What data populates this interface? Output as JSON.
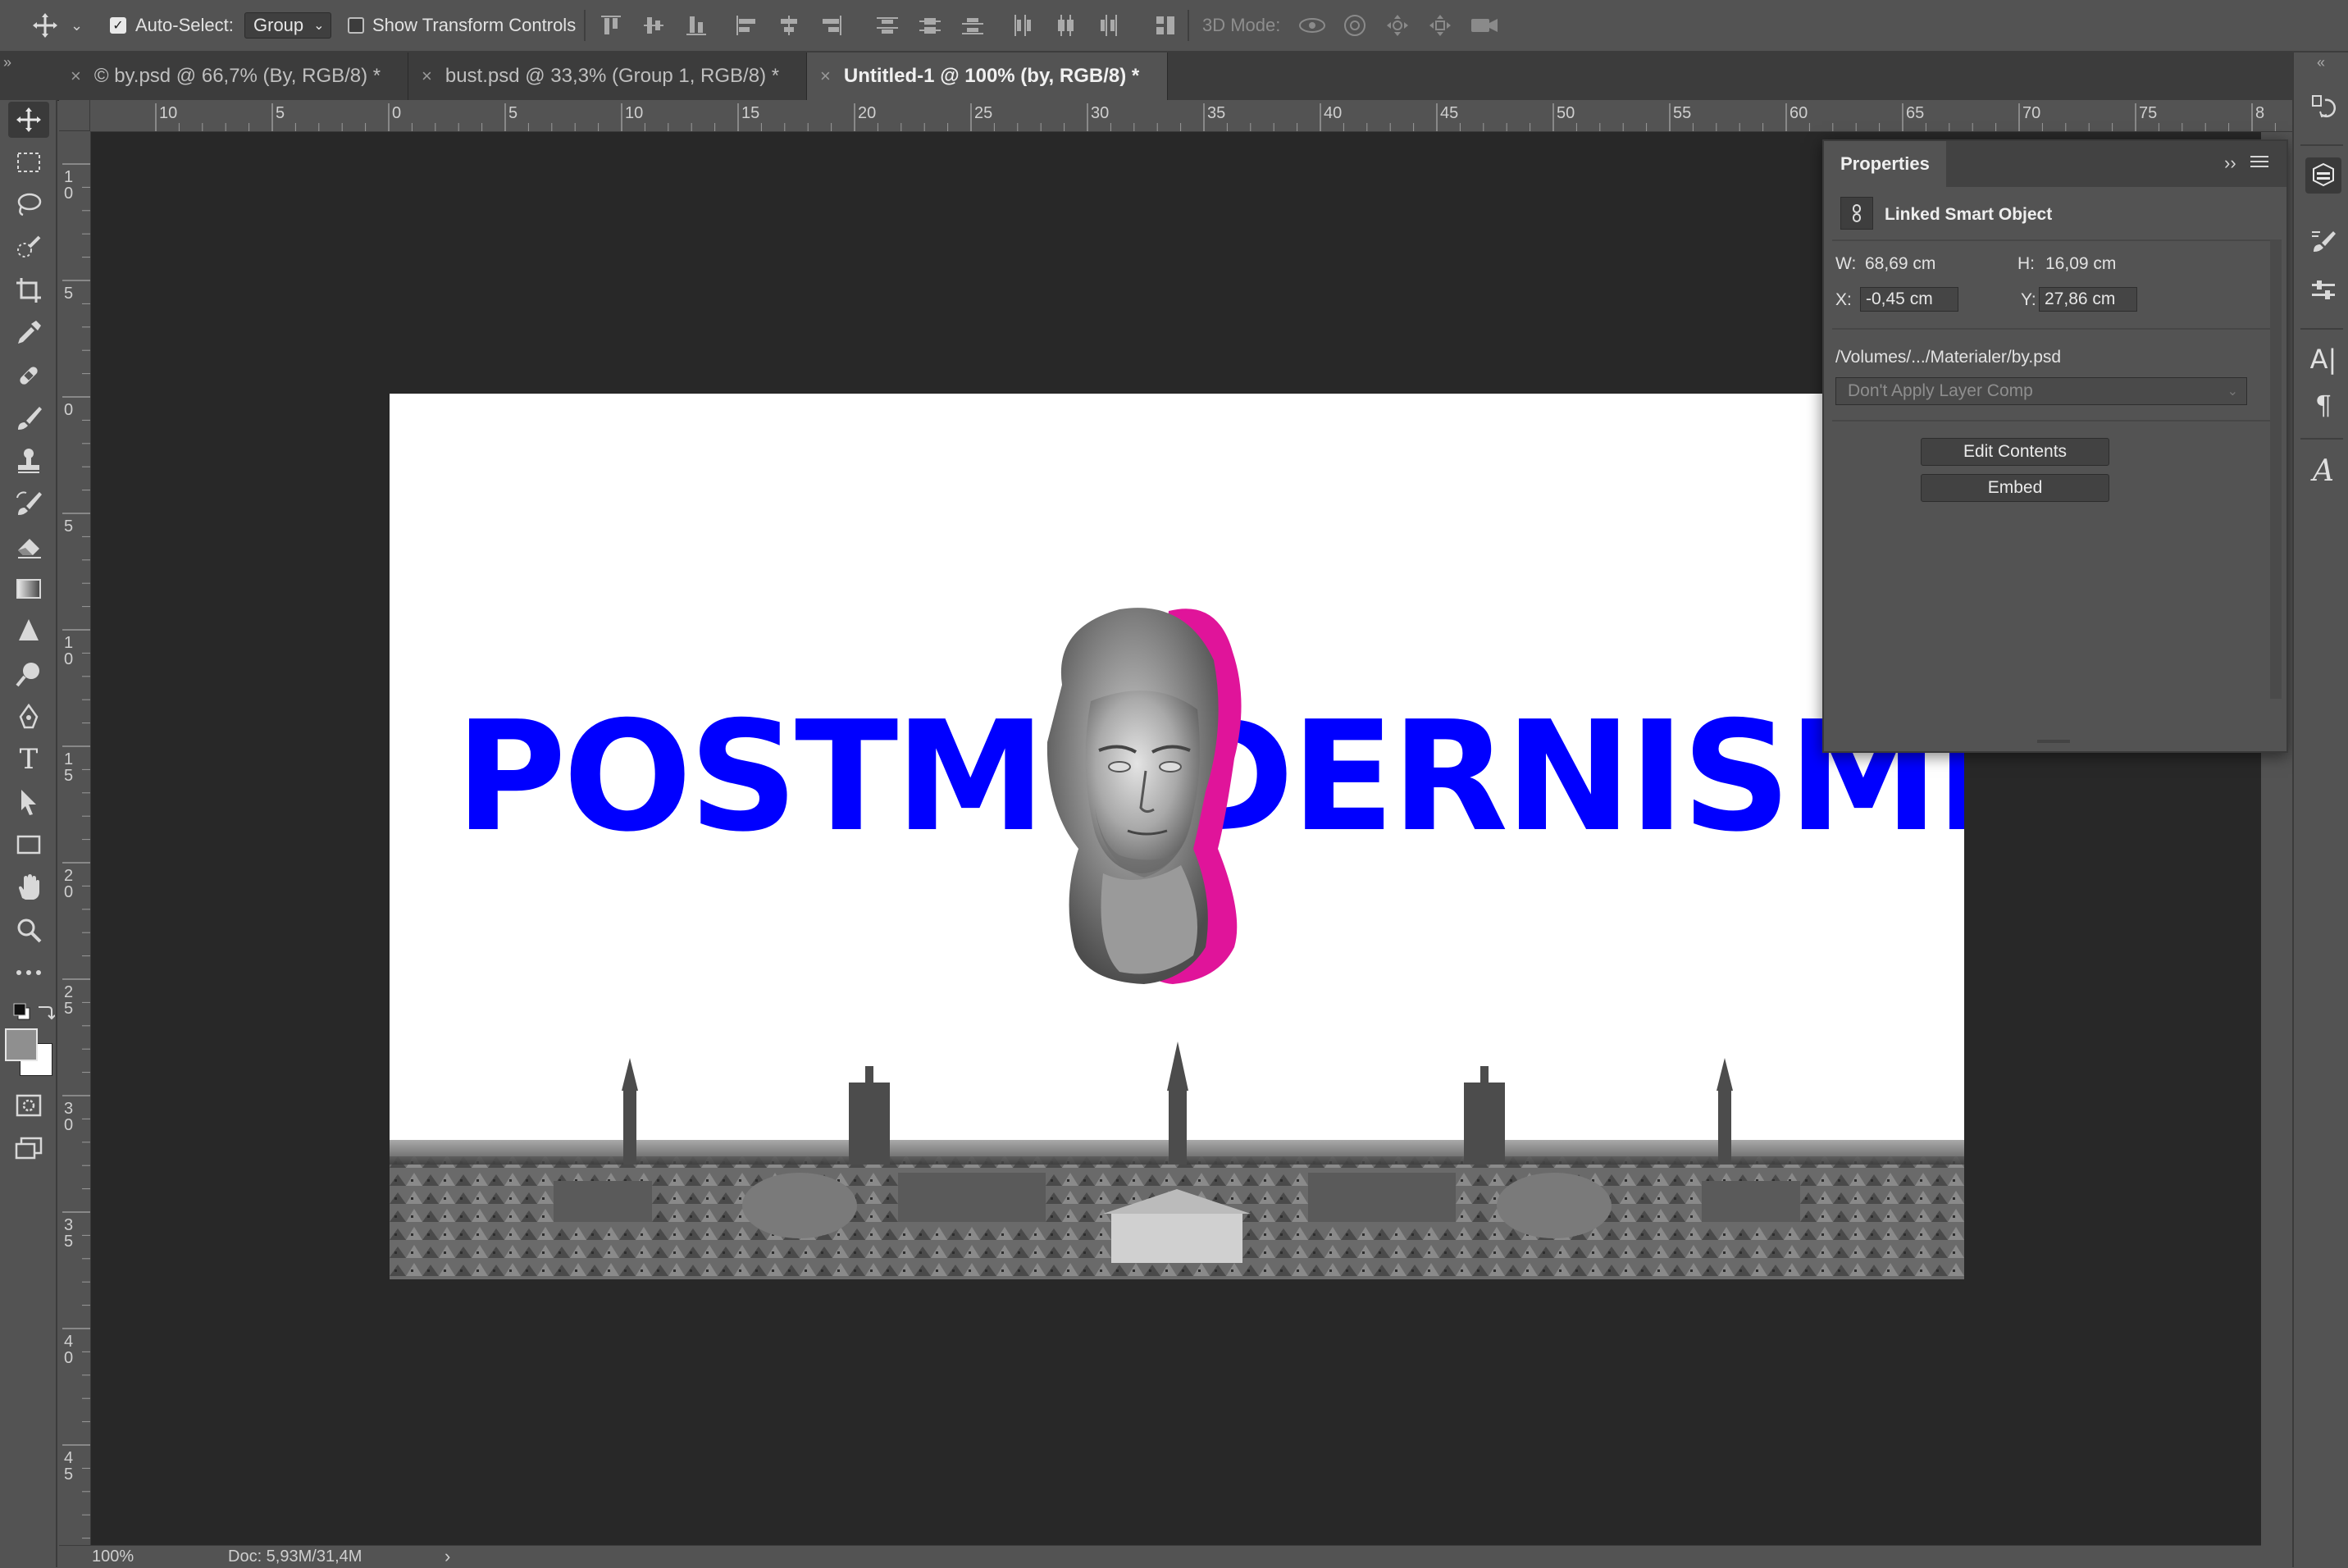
{
  "options_bar": {
    "auto_select_label": "Auto-Select:",
    "auto_select_checked": true,
    "auto_select_target": "Group",
    "show_transform_label": "Show Transform Controls",
    "show_transform_checked": false,
    "mode_3d_label": "3D Mode:"
  },
  "tabs": [
    {
      "label": "© by.psd @ 66,7% (By, RGB/8) *",
      "active": false
    },
    {
      "label": "bust.psd @ 33,3% (Group 1, RGB/8) *",
      "active": false
    },
    {
      "label": "Untitled-1 @ 100% (by, RGB/8) *",
      "active": true
    }
  ],
  "tabbar_collapse_glyph": "»",
  "ruler": {
    "horizontal": [
      "10",
      "5",
      "0",
      "5",
      "10",
      "15",
      "20",
      "25",
      "30",
      "35",
      "40",
      "45",
      "50",
      "55",
      "60",
      "65",
      "70",
      "75",
      "8"
    ],
    "vertical": [
      "1\n0",
      "5",
      "0",
      "5",
      "1\n0",
      "1\n5",
      "2\n0",
      "2\n5",
      "3\n0",
      "3\n5",
      "4\n0",
      "4\n5"
    ]
  },
  "canvas": {
    "headline": "POSTMODERNISME",
    "headline_color": "#0000ff",
    "accent_color": "#e0149a"
  },
  "properties": {
    "tab_label": "Properties",
    "object_type": "Linked Smart Object",
    "w_label": "W:",
    "w_value": "68,69 cm",
    "h_label": "H:",
    "h_value": "16,09 cm",
    "x_label": "X:",
    "x_value": "-0,45 cm",
    "y_label": "Y:",
    "y_value": "27,86 cm",
    "path": "/Volumes/.../Materialer/by.psd",
    "layer_comp": "Don't Apply Layer Comp",
    "edit_contents": "Edit Contents",
    "embed": "Embed"
  },
  "status": {
    "zoom": "100%",
    "doc": "Doc: 5,93M/31,4M",
    "arrow": "›"
  }
}
